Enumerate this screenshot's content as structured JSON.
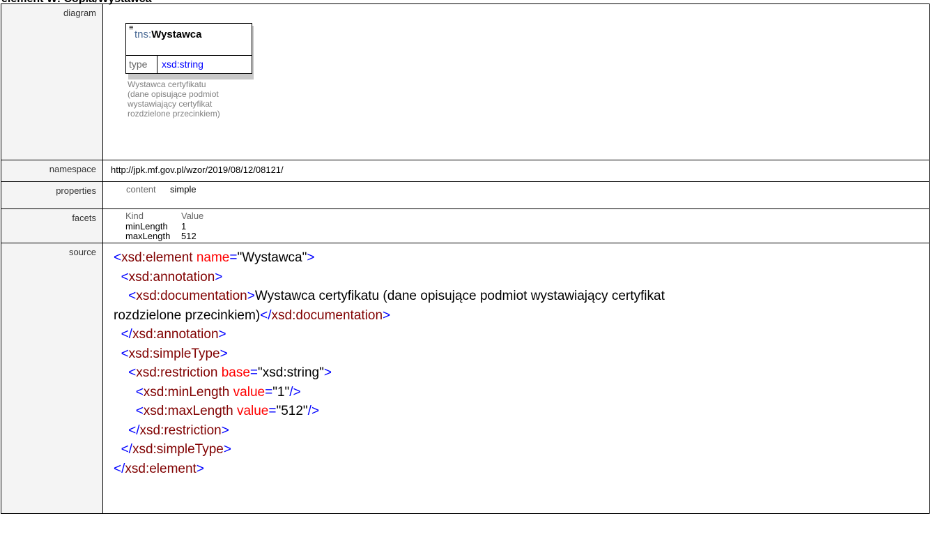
{
  "heading": "element W: Copia/Wystawca",
  "rows": {
    "diagram_label": "diagram",
    "namespace_label": "namespace",
    "properties_label": "properties",
    "facets_label": "facets",
    "source_label": "source"
  },
  "diagram": {
    "prefix": "tns:",
    "element_name": "Wystawca",
    "type_key": "type",
    "type_value": "xsd:string",
    "doc_lines": [
      "Wystawca certyfikatu",
      "(dane opisujące podmiot",
      "wystawiający certyfikat",
      "rozdzielone przecinkiem)"
    ]
  },
  "namespace": "http://jpk.mf.gov.pl/wzor/2019/08/12/08121/",
  "properties": {
    "key": "content",
    "value": "simple"
  },
  "facets": {
    "header_kind": "Kind",
    "header_value": "Value",
    "items": [
      {
        "kind": "minLength",
        "value": "1"
      },
      {
        "kind": "maxLength",
        "value": "512"
      }
    ]
  },
  "source": {
    "line1": {
      "open": "<",
      "tag": "xsd:element",
      "sp": " ",
      "attr": "name",
      "eq": "=",
      "val": "\"Wystawca\"",
      "close": ">"
    },
    "line2": {
      "indent": "  ",
      "open": "<",
      "tag": "xsd:annotation",
      "close": ">"
    },
    "line3": {
      "indent": "    ",
      "open": "<",
      "tag": "xsd:documentation",
      "close": ">",
      "text": "Wystawca certyfikatu (dane opisujące podmiot wystawiający certyfikat"
    },
    "line4": {
      "text": "rozdzielone przecinkiem)",
      "open": "</",
      "tag": "xsd:documentation",
      "close": ">"
    },
    "line5": {
      "indent": "  ",
      "open": "</",
      "tag": "xsd:annotation",
      "close": ">"
    },
    "line6": {
      "indent": "  ",
      "open": "<",
      "tag": "xsd:simpleType",
      "close": ">"
    },
    "line7": {
      "indent": "    ",
      "open": "<",
      "tag": "xsd:restriction",
      "sp": " ",
      "attr": "base",
      "eq": "=",
      "val": "\"xsd:string\"",
      "close": ">"
    },
    "line8": {
      "indent": "      ",
      "open": "<",
      "tag": "xsd:minLength",
      "sp": " ",
      "attr": "value",
      "eq": "=",
      "val": "\"1\"",
      "close": "/>"
    },
    "line9": {
      "indent": "      ",
      "open": "<",
      "tag": "xsd:maxLength",
      "sp": " ",
      "attr": "value",
      "eq": "=",
      "val": "\"512\"",
      "close": "/>"
    },
    "line10": {
      "indent": "    ",
      "open": "</",
      "tag": "xsd:restriction",
      "close": ">"
    },
    "line11": {
      "indent": "  ",
      "open": "</",
      "tag": "xsd:simpleType",
      "close": ">"
    },
    "line12": {
      "open": "</",
      "tag": "xsd:element",
      "close": ">"
    }
  }
}
